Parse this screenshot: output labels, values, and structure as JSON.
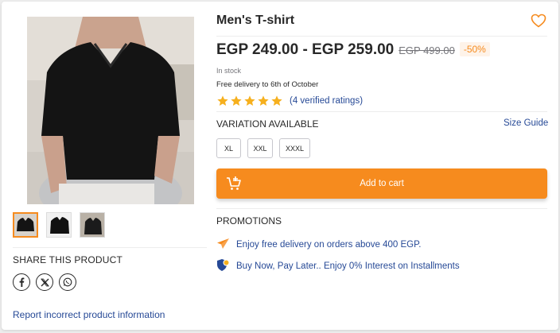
{
  "product": {
    "title": "Men's T-shirt",
    "price": "EGP 249.00 - EGP 259.00",
    "old_price": "EGP 499.00",
    "discount": "-50%",
    "stock": "In stock",
    "delivery": "Free delivery to 6th of October",
    "stars": 5,
    "ratings_text": "(4 verified ratings)"
  },
  "gallery": {
    "thumb_count": 3,
    "active_index": 0
  },
  "share": {
    "title": "SHARE THIS PRODUCT",
    "icons": [
      "facebook-icon",
      "x-icon",
      "whatsapp-icon"
    ]
  },
  "report": "Report incorrect product information",
  "variation": {
    "title": "VARIATION AVAILABLE",
    "size_guide": "Size Guide",
    "sizes": [
      "XL",
      "XXL",
      "XXXL"
    ]
  },
  "cart": {
    "label": "Add to cart"
  },
  "promotions": {
    "title": "PROMOTIONS",
    "items": [
      "Enjoy free delivery on orders above 400 EGP.",
      "Buy Now, Pay Later.. Enjoy 0% Interest on Installments"
    ]
  },
  "colors": {
    "accent": "#f68b1e",
    "link": "#264996",
    "star": "#f6b01e"
  }
}
